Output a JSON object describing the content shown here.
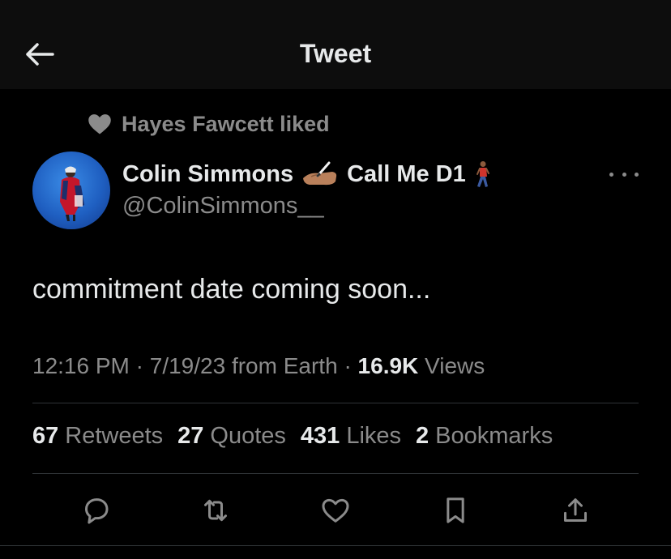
{
  "header": {
    "title": "Tweet",
    "back_icon": "arrow-left-icon"
  },
  "social_context": {
    "icon": "heart-filled-icon",
    "text": "Hayes Fawcett liked"
  },
  "author": {
    "name_part1": "Colin Simmons",
    "emoji1": "✍🏽",
    "name_part2": "Call Me D1",
    "emoji2": "🚶🏾",
    "handle": "@ColinSimmons__"
  },
  "tweet": {
    "text": "commitment date coming soon...",
    "time": "12:16 PM",
    "date": "7/19/23",
    "source": "from Earth",
    "views_count": "16.9K",
    "views_label": "Views"
  },
  "stats": [
    {
      "count": "67",
      "label": "Retweets"
    },
    {
      "count": "27",
      "label": "Quotes"
    },
    {
      "count": "431",
      "label": "Likes"
    },
    {
      "count": "2",
      "label": "Bookmarks"
    }
  ],
  "actions": [
    "reply-icon",
    "retweet-icon",
    "like-icon",
    "bookmark-icon",
    "share-icon"
  ],
  "colors": {
    "background": "#000000",
    "header_bg": "#0d0d0d",
    "text_primary": "#e7e9ea",
    "text_secondary": "#8b8b8b",
    "divider": "#2f3336"
  }
}
